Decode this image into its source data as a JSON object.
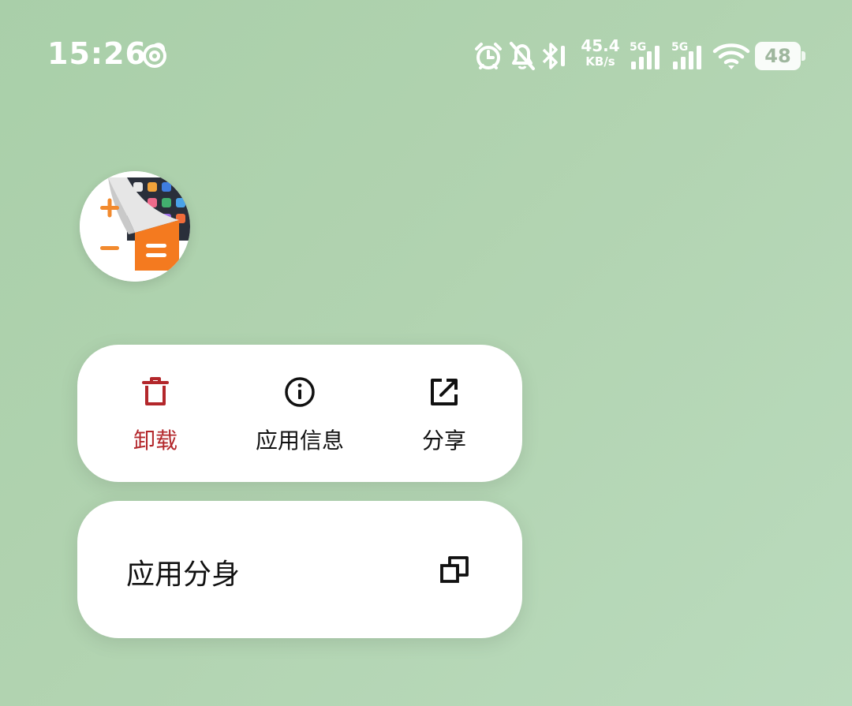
{
  "status_bar": {
    "time": "15:26",
    "network_speed_value": "45.4",
    "network_speed_unit": "KB/s",
    "sim1_label": "5G",
    "sim2_label": "5G",
    "battery_level": "48",
    "icons": [
      "app-notification-swirl-icon",
      "alarm-icon",
      "bell-muted-icon",
      "bluetooth-icon",
      "signal-icon",
      "signal-icon",
      "wifi-icon",
      "battery-icon"
    ]
  },
  "app": {
    "icon": "calculator-app-icon"
  },
  "menu": {
    "actions": [
      {
        "label": "卸载",
        "icon": "trash-icon",
        "color": "#b3272b"
      },
      {
        "label": "应用信息",
        "icon": "info-icon"
      },
      {
        "label": "分享",
        "icon": "share-icon"
      }
    ],
    "rows": [
      {
        "label": "应用分身",
        "icon": "clone-icon"
      }
    ]
  },
  "colors": {
    "background": "#b1d3b0",
    "card": "#ffffff",
    "danger": "#b3272b",
    "text": "#111111"
  }
}
